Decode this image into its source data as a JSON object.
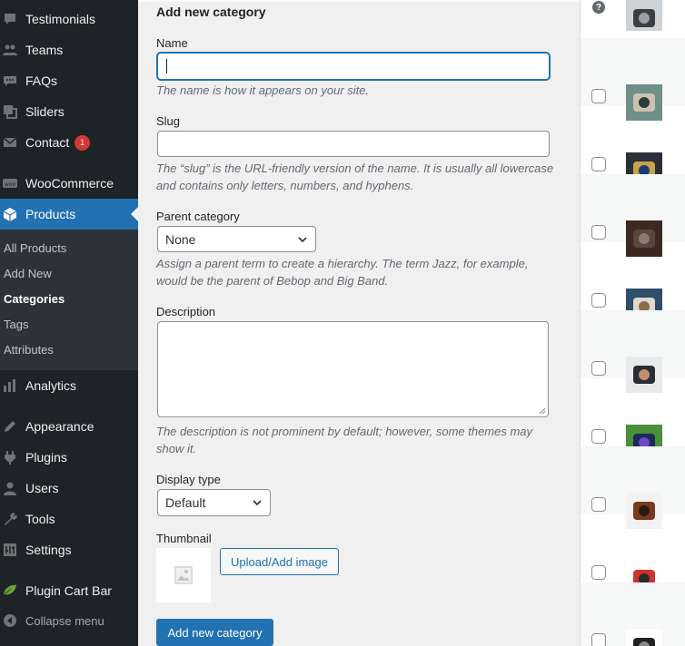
{
  "sidebar": {
    "items": [
      {
        "label": "Testimonials",
        "icon": "testimonials-icon"
      },
      {
        "label": "Teams",
        "icon": "teams-icon"
      },
      {
        "label": "FAQs",
        "icon": "faqs-icon"
      },
      {
        "label": "Sliders",
        "icon": "sliders-icon"
      },
      {
        "label": "Contact",
        "icon": "envelope-icon",
        "badge": "1"
      },
      {
        "label": "WooCommerce",
        "icon": "woocommerce-icon"
      },
      {
        "label": "Products",
        "icon": "products-icon",
        "current": true
      },
      {
        "label": "Analytics",
        "icon": "analytics-icon"
      },
      {
        "label": "Appearance",
        "icon": "appearance-icon"
      },
      {
        "label": "Plugins",
        "icon": "plugins-icon"
      },
      {
        "label": "Users",
        "icon": "users-icon"
      },
      {
        "label": "Tools",
        "icon": "tools-icon"
      },
      {
        "label": "Settings",
        "icon": "settings-icon"
      },
      {
        "label": "Plugin Cart Bar",
        "icon": "cart-bar-icon"
      }
    ],
    "submenu": [
      "All Products",
      "Add New",
      "Categories",
      "Tags",
      "Attributes"
    ],
    "submenu_current": "Categories",
    "collapse_label": "Collapse menu"
  },
  "form": {
    "heading": "Add new category",
    "name_label": "Name",
    "name_value": "",
    "name_desc": "The name is how it appears on your site.",
    "slug_label": "Slug",
    "slug_value": "",
    "slug_desc": "The “slug” is the URL-friendly version of the name. It is usually all lowercase and contains only letters, numbers, and hyphens.",
    "parent_label": "Parent category",
    "parent_value": "None",
    "parent_desc": "Assign a parent term to create a hierarchy. The term Jazz, for example, would be the parent of Bebop and Big Band.",
    "description_label": "Description",
    "description_value": "",
    "description_desc": "The description is not prominent by default; however, some themes may show it.",
    "display_type_label": "Display type",
    "display_type_value": "Default",
    "thumbnail_label": "Thumbnail",
    "upload_button": "Upload/Add image",
    "submit_button": "Add new category"
  },
  "table": {
    "help_glyph": "?",
    "rows": [
      {
        "image": "kitchen-appliances"
      },
      {
        "image": "laptop-and-notebook"
      },
      {
        "image": "gold-watch"
      },
      {
        "image": "dark-wood"
      },
      {
        "image": "earphones"
      },
      {
        "image": "man-with-sunglasses"
      },
      {
        "image": "smartphones"
      },
      {
        "image": "leather-shoes"
      },
      {
        "image": "red-t-shirt"
      },
      {
        "image": "sport-watch"
      }
    ]
  },
  "colors": {
    "accent": "#2271b1",
    "sidebar_bg": "#1d2327",
    "submenu_bg": "#2c3338",
    "badge": "#d63638"
  }
}
